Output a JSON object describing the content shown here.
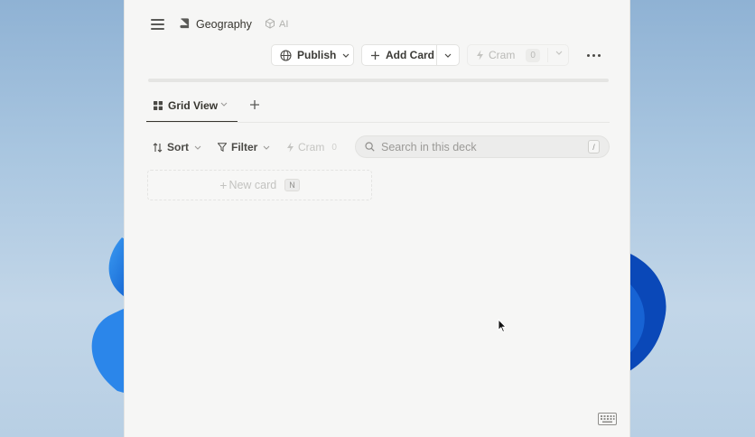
{
  "header": {
    "deck_title": "Geography",
    "ai_label": "AI"
  },
  "actions": {
    "publish_label": "Publish",
    "add_card_label": "Add Card",
    "cram_label": "Cram",
    "cram_count": "0"
  },
  "views": {
    "active_tab": "Grid View"
  },
  "toolbar": {
    "sort_label": "Sort",
    "filter_label": "Filter",
    "cram_label": "Cram",
    "cram_count": "0",
    "search_placeholder": "Search in this deck",
    "search_shortcut": "/"
  },
  "cards": {
    "new_card_label": "New card",
    "new_card_shortcut": "N"
  },
  "icons": {
    "menu": "hamburger-icon",
    "deck": "book-icon",
    "ai": "cube-icon",
    "publish": "globe-icon",
    "add": "plus-icon",
    "cram": "lightning-icon",
    "more": "more-horizontal-icon",
    "grid": "grid-icon",
    "sort": "sort-icon",
    "filter": "filter-icon",
    "search": "search-icon",
    "keyboard": "keyboard-icon"
  },
  "colors": {
    "app_background": "#f6f6f5",
    "text": "#37352f",
    "muted": "#9b9a97",
    "wallpaper_accent": "#1f6fe0"
  }
}
